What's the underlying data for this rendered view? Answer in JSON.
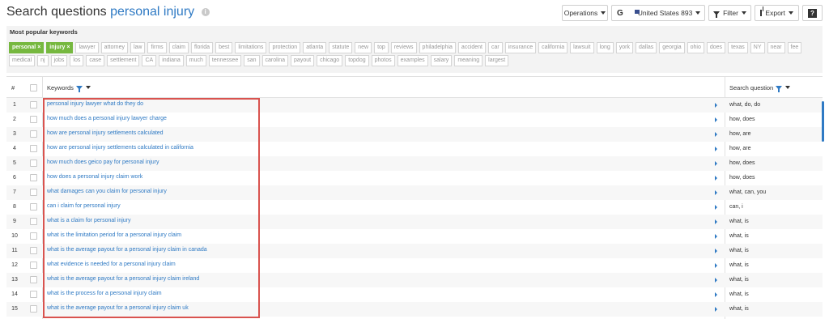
{
  "header": {
    "title_prefix": "Search questions",
    "title_keyword": "personal injury",
    "info_icon": "i"
  },
  "toolbar": {
    "operations_label": "Operations",
    "engine_logo": "G",
    "country_label": "United States 893",
    "filter_label": "Filter",
    "export_label": "Export",
    "help_label": "?"
  },
  "popular": {
    "title": "Most popular keywords",
    "active_tags": [
      "personal",
      "injury"
    ],
    "tags": [
      "lawyer",
      "attorney",
      "law",
      "firms",
      "claim",
      "florida",
      "best",
      "limitations",
      "protection",
      "atlanta",
      "statute",
      "new",
      "top",
      "reviews",
      "philadelphia",
      "accident",
      "car",
      "insurance",
      "california",
      "lawsuit",
      "long",
      "york",
      "dallas",
      "georgia",
      "ohio",
      "does",
      "texas",
      "NY",
      "near",
      "fee",
      "medical",
      "nj",
      "jobs",
      "los",
      "case",
      "settlement",
      "CA",
      "indiana",
      "much",
      "tennessee",
      "san",
      "carolina",
      "payout",
      "chicago",
      "topdog",
      "photos",
      "examples",
      "salary",
      "meaning",
      "largest"
    ]
  },
  "table": {
    "col_num": "#",
    "col_keywords": "Keywords",
    "col_question": "Search question",
    "rows": [
      {
        "n": "1",
        "kw": "personal injury lawyer what do they do",
        "q": "what, do, do"
      },
      {
        "n": "2",
        "kw": "how much does a personal injury lawyer charge",
        "q": "how, does"
      },
      {
        "n": "3",
        "kw": "how are personal injury settlements calculated",
        "q": "how, are"
      },
      {
        "n": "4",
        "kw": "how are personal injury settlements calculated in california",
        "q": "how, are"
      },
      {
        "n": "5",
        "kw": "how much does geico pay for personal injury",
        "q": "how, does"
      },
      {
        "n": "6",
        "kw": "how does a personal injury claim work",
        "q": "how, does"
      },
      {
        "n": "7",
        "kw": "what damages can you claim for personal injury",
        "q": "what, can, you"
      },
      {
        "n": "8",
        "kw": "can i claim for personal injury",
        "q": "can, i"
      },
      {
        "n": "9",
        "kw": "what is a claim for personal injury",
        "q": "what, is"
      },
      {
        "n": "10",
        "kw": "what is the limitation period for a personal injury claim",
        "q": "what, is"
      },
      {
        "n": "11",
        "kw": "what is the average payout for a personal injury claim in canada",
        "q": "what, is"
      },
      {
        "n": "12",
        "kw": "what evidence is needed for a personal injury claim",
        "q": "what, is"
      },
      {
        "n": "13",
        "kw": "what is the average payout for a personal injury claim ireland",
        "q": "what, is"
      },
      {
        "n": "14",
        "kw": "what is the process for a personal injury claim",
        "q": "what, is"
      },
      {
        "n": "15",
        "kw": "what is the average payout for a personal injury claim uk",
        "q": "what, is"
      }
    ]
  },
  "colors": {
    "accent": "#2f7ac4",
    "tag_active": "#76b83f",
    "highlight": "#d9534f"
  }
}
